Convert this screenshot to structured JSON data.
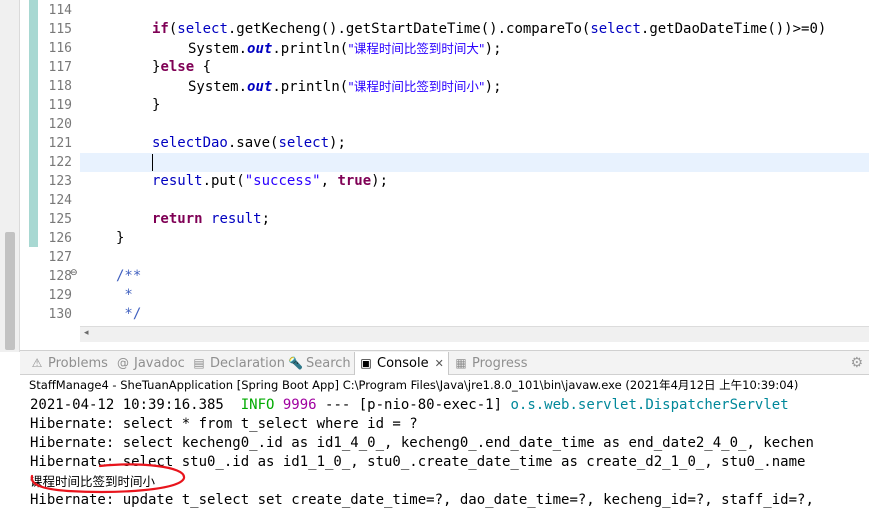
{
  "editor": {
    "line_numbers": [
      "114",
      "115",
      "116",
      "117",
      "118",
      "119",
      "120",
      "121",
      "122",
      "123",
      "124",
      "125",
      "126",
      "127",
      "128",
      "129",
      "130"
    ],
    "lines": {
      "l115": {
        "kw_if": "if",
        "p1": "(",
        "var_select1": "select",
        "p2": ".getKecheng().getStartDateTime().compareTo(",
        "var_select2": "select",
        "p3": ".getDaoDateTime())>=0)"
      },
      "l116": {
        "p1": "System.",
        "out": "out",
        "p2": ".println(",
        "str": "\"课程时间比签到时间大\"",
        "p3": ");"
      },
      "l117": {
        "p1": "}",
        "kw_else": "else",
        "p2": " {"
      },
      "l118": {
        "p1": "System.",
        "out": "out",
        "p2": ".println(",
        "str": "\"课程时间比签到时间小\"",
        "p3": ");"
      },
      "l119": {
        "p1": "}"
      },
      "l121": {
        "var_dao": "selectDao",
        "p1": ".save(",
        "var_select": "select",
        "p2": ");"
      },
      "l123": {
        "var_result": "result",
        "p1": ".put(",
        "str": "\"success\"",
        "p2": ", ",
        "kw_true": "true",
        "p3": ");"
      },
      "l125": {
        "kw_return": "return",
        "p1": " ",
        "var_result": "result",
        "p2": ";"
      },
      "l126": {
        "p1": "}"
      },
      "l128": {
        "cmt": "/**"
      },
      "l129": {
        "cmt": " *"
      },
      "l130": {
        "cmt": " */"
      }
    }
  },
  "views": {
    "tabs": [
      {
        "label": "Problems",
        "icon": "⚠"
      },
      {
        "label": "Javadoc",
        "icon": "@"
      },
      {
        "label": "Declaration",
        "icon": "▤"
      },
      {
        "label": "Search",
        "icon": "🔦"
      },
      {
        "label": "Console",
        "icon": "▣",
        "close": "✕"
      },
      {
        "label": "Progress",
        "icon": "▦"
      }
    ],
    "menu_icon": "⚙"
  },
  "console": {
    "header": "StaffManage4 - SheTuanApplication [Spring Boot App] C:\\Program Files\\Java\\jre1.8.0_101\\bin\\javaw.exe (2021年4月12日 上午10:39:04)",
    "lines": {
      "c1": {
        "ts": "2021-04-12 10:39:16.385  ",
        "level": "INFO",
        "pid": " 9996",
        "mid": " --- [p-nio-80-exec-1] ",
        "logger": "o.s.web.servlet.DispatcherServlet"
      },
      "c2": "Hibernate: select * from t_select where id = ?",
      "c3": "Hibernate: select kecheng0_.id as id1_4_0_, kecheng0_.end_date_time as end_date2_4_0_, kechen",
      "c4": "Hibernate: select stu0_.id as id1_1_0_, stu0_.create_date_time as create_d2_1_0_, stu0_.name",
      "c5": "课程时间比签到时间小",
      "c6": "Hibernate: update t_select set create_date_time=?, dao_date_time=?, kecheng_id=?, staff_id=?,"
    }
  },
  "colors": {
    "keyword": "#7f0055",
    "field": "#0000c0",
    "string": "#2a00ff",
    "comment": "#3f5fbf",
    "info": "#00aa00",
    "annotation": "#e8141c"
  }
}
